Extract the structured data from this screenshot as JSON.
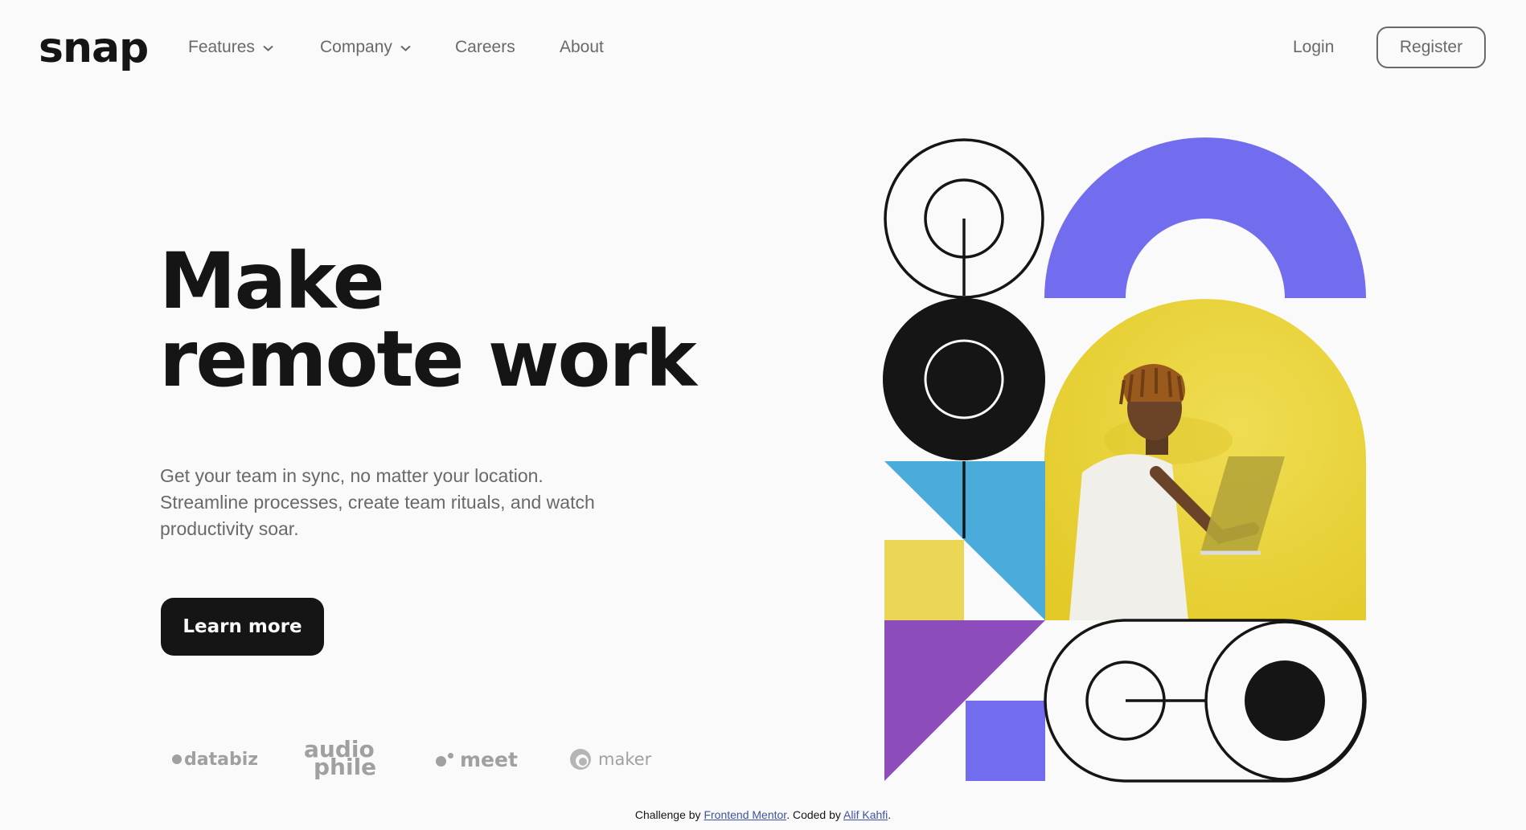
{
  "brand": {
    "logo": "snap"
  },
  "nav": {
    "features": "Features",
    "company": "Company",
    "careers": "Careers",
    "about": "About"
  },
  "auth": {
    "login": "Login",
    "register": "Register"
  },
  "hero": {
    "headline_line1": "Make",
    "headline_line2": "remote work",
    "lede": "Get your team in sync, no matter your location. Streamline processes, create team rituals, and watch productivity soar.",
    "cta": "Learn more"
  },
  "clients": {
    "databiz": "databiz",
    "audiophile_1": "audio",
    "audiophile_2": "phile",
    "meet": "meet",
    "maker": "maker"
  },
  "attribution": {
    "prefix": "Challenge by ",
    "fm": "Frontend Mentor",
    "middle": ". Coded by ",
    "author": "Alif Kahfi",
    "suffix": "."
  },
  "colors": {
    "ink": "#151515",
    "muted": "#696969",
    "purple": "#726cee",
    "violet": "#8d4cbb",
    "sky": "#4bacdb",
    "yellow": "#ebd656",
    "photo_yellow": "#e6cd31"
  }
}
